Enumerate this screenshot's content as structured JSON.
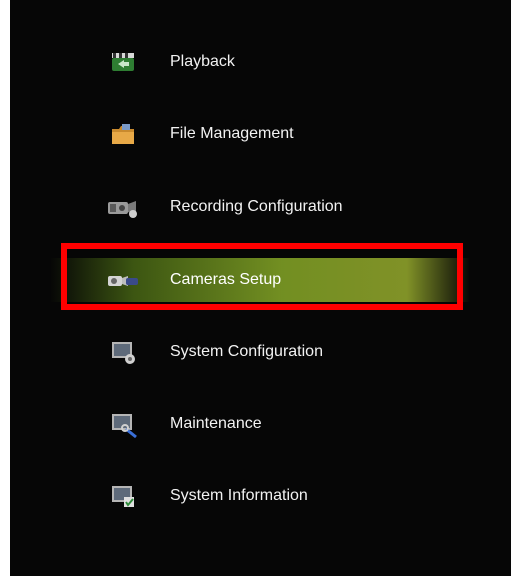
{
  "menu": {
    "items": [
      {
        "label": "Playback",
        "icon": "playback-icon"
      },
      {
        "label": "File Management",
        "icon": "folder-icon"
      },
      {
        "label": "Recording Configuration",
        "icon": "recording-camera-icon"
      },
      {
        "label": "Cameras Setup",
        "icon": "camera-setup-icon",
        "selected": true
      },
      {
        "label": "System Configuration",
        "icon": "system-config-icon"
      },
      {
        "label": "Maintenance",
        "icon": "maintenance-icon"
      },
      {
        "label": "System Information",
        "icon": "system-info-icon"
      }
    ]
  },
  "colors": {
    "background": "#060606",
    "selection_green": "#7a9a23",
    "highlight_box": "#ff0000",
    "text": "#f2f2f2"
  }
}
